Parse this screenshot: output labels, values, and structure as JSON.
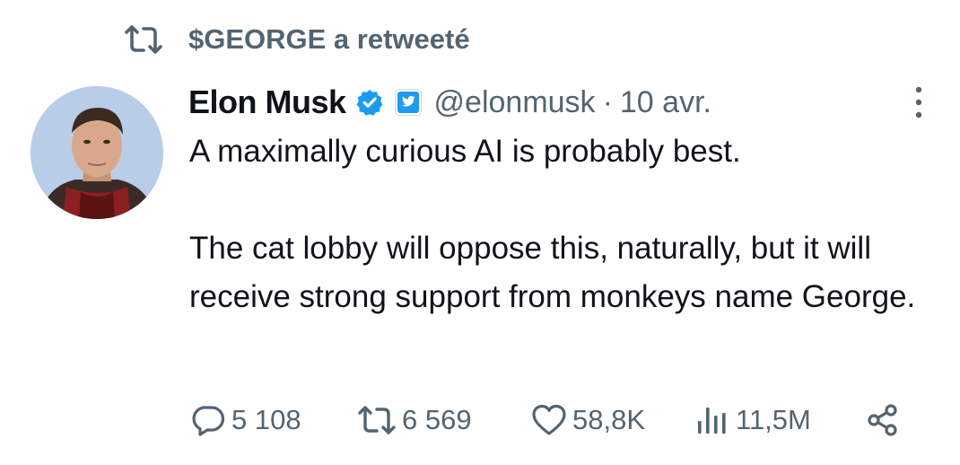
{
  "retweet_header": {
    "text": "$GEORGE a retweeté",
    "icon": "retweet-icon"
  },
  "tweet": {
    "author": {
      "name": "Elon Musk",
      "handle": "@elonmusk",
      "verified_icon": "verified-badge-icon",
      "affiliate_icon": "x-affiliate-badge-icon",
      "avatar_icon": "profile-photo"
    },
    "separator": "·",
    "time": "10 avr.",
    "text": {
      "line1": "A maximally curious AI is probably best.",
      "line2": "The cat lobby will oppose this, naturally, but it will receive strong support from monkeys name George."
    },
    "actions": {
      "replies": "5 108",
      "retweets": "6 569",
      "likes": "58,8K",
      "views": "11,5M"
    }
  },
  "colors": {
    "text_primary": "#0f1419",
    "text_secondary": "#536471",
    "verified_blue": "#1d9bf0"
  }
}
